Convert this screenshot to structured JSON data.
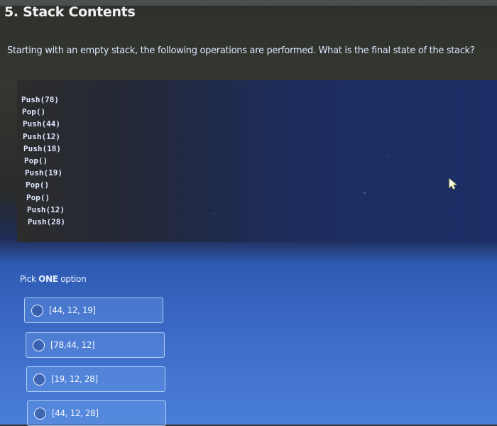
{
  "question": {
    "title": "5. Stack Contents",
    "prompt": "Starting with an empty stack, the following operations are performed.  What is the final state of the stack?",
    "operations": [
      "Push(78)",
      "Pop()",
      "Push(44)",
      "Push(12)",
      "Push(18)",
      "Pop()",
      "Push(19)",
      "Pop()",
      "Pop()",
      "Push(12)",
      "Push(28)"
    ]
  },
  "answer": {
    "pick_prefix": "Pick ",
    "pick_emphasis": "ONE",
    "pick_suffix": " option",
    "options": [
      {
        "label": "[44, 12, 19]",
        "selected": false
      },
      {
        "label": "[78,44, 12]",
        "selected": false
      },
      {
        "label": "[19, 12, 28]",
        "selected": false
      },
      {
        "label": "[44, 12, 28]",
        "selected": false
      }
    ]
  },
  "cursor": {
    "icon": "mouse-pointer-icon"
  }
}
